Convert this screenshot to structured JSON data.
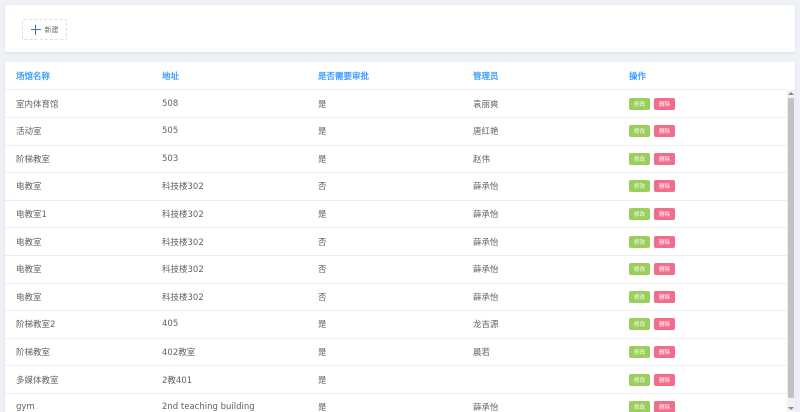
{
  "toolbar": {
    "new_label": "新建",
    "new_icon": "plus-icon"
  },
  "table": {
    "headers": [
      "场馆名称",
      "地址",
      "是否需要审批",
      "管理员",
      "操作"
    ],
    "edit_label": "修改",
    "delete_label": "删除",
    "rows": [
      [
        "室内体育馆",
        "508",
        "是",
        "袁丽爽"
      ],
      [
        "活动室",
        "505",
        "是",
        "唐红艳"
      ],
      [
        "阶梯教室",
        "503",
        "是",
        "赵伟"
      ],
      [
        "电教室",
        "科技楼302",
        "否",
        "薛承怡"
      ],
      [
        "电教室1",
        "科技楼302",
        "是",
        "薛承怡"
      ],
      [
        "电教室",
        "科技楼302",
        "否",
        "薛承怡"
      ],
      [
        "电教室",
        "科技楼302",
        "否",
        "薛承怡"
      ],
      [
        "电教室",
        "科技楼302",
        "否",
        "薛承怡"
      ],
      [
        "阶梯教室2",
        "405",
        "是",
        "龙吉源"
      ],
      [
        "阶梯教室",
        "402教室",
        "是",
        "晨若"
      ],
      [
        "多媒体教室",
        "2教401",
        "是",
        ""
      ],
      [
        "gym",
        "2nd teaching building",
        "是",
        "薛承怡"
      ]
    ]
  },
  "colors": {
    "header_text": "#409eff",
    "edit": "#9bce5a",
    "delete": "#f06d8c"
  }
}
